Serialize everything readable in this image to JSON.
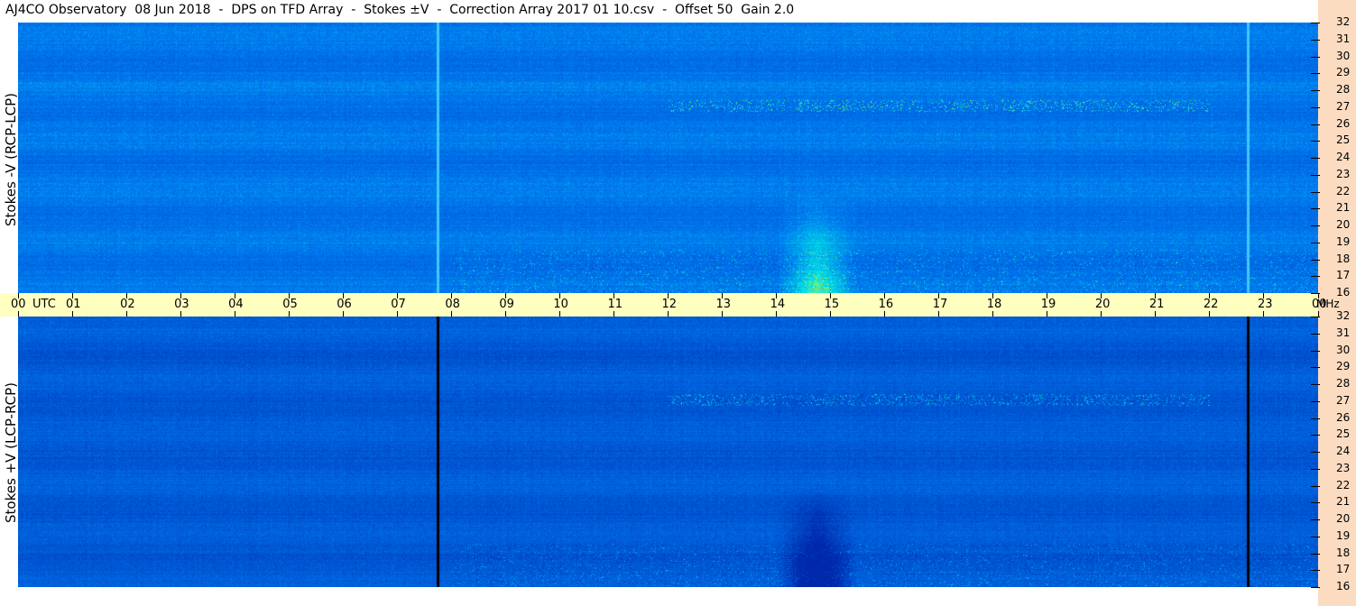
{
  "title": "AJ4CO Observatory  08 Jun 2018  -  DPS on TFD Array  -  Stokes ±V  -  Correction Array 2017 01 10.csv  -  Offset 50  Gain 2.0",
  "colors": {
    "background_panel_top": "#1e64e6",
    "background_panel_bottom": "#1450dc",
    "axis_band": "#ffffc0",
    "right_strip": "#fcdcc0"
  },
  "chart_data": [
    {
      "type": "heatmap",
      "name": "top-panel",
      "ylabel": "Stokes -V (RCP-LCP)",
      "x_ticks": [
        "00",
        "01",
        "02",
        "03",
        "04",
        "05",
        "06",
        "07",
        "08",
        "09",
        "10",
        "11",
        "12",
        "13",
        "14",
        "15",
        "16",
        "17",
        "18",
        "19",
        "20",
        "21",
        "22",
        "23",
        "00"
      ],
      "x_unit_label": "UTC",
      "y_ticks": [
        32,
        31,
        30,
        29,
        28,
        27,
        26,
        25,
        24,
        23,
        22,
        21,
        20,
        19,
        18,
        17,
        16
      ],
      "ylim": [
        16,
        32
      ],
      "xlim": [
        0,
        24
      ],
      "colormap": "blue-cyan-yellow-red",
      "features": [
        {
          "kind": "vertical-line",
          "x_hours": 7.75,
          "color": "#40c8ff"
        },
        {
          "kind": "vertical-line",
          "x_hours": 22.7,
          "color": "#40c8ff"
        },
        {
          "kind": "burst",
          "x_hours_range": [
            14.0,
            15.5
          ],
          "freq_range": [
            16,
            22
          ]
        }
      ]
    },
    {
      "type": "heatmap",
      "name": "bottom-panel",
      "ylabel": "Stokes +V (LCP-RCP)",
      "x_ticks": [
        "00",
        "01",
        "02",
        "03",
        "04",
        "05",
        "06",
        "07",
        "08",
        "09",
        "10",
        "11",
        "12",
        "13",
        "14",
        "15",
        "16",
        "17",
        "18",
        "19",
        "20",
        "21",
        "22",
        "23",
        "00"
      ],
      "y_ticks": [
        32,
        31,
        30,
        29,
        28,
        27,
        26,
        25,
        24,
        23,
        22,
        21,
        20,
        19,
        18,
        17,
        16
      ],
      "y_unit_label": "MHz",
      "ylim": [
        16,
        32
      ],
      "xlim": [
        0,
        24
      ],
      "colormap": "blue-cyan-yellow-red",
      "features": [
        {
          "kind": "vertical-line",
          "x_hours": 7.75,
          "color": "#000000"
        },
        {
          "kind": "vertical-line",
          "x_hours": 22.7,
          "color": "#000000"
        },
        {
          "kind": "burst",
          "x_hours_range": [
            14.0,
            15.5
          ],
          "freq_range": [
            16,
            22
          ]
        }
      ]
    }
  ]
}
